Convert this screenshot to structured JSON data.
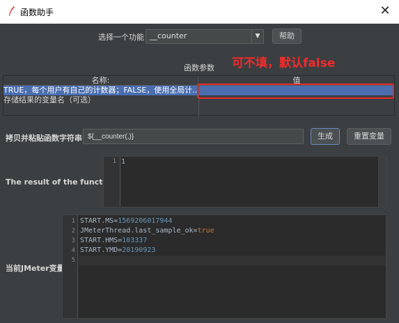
{
  "window": {
    "title": "函数助手",
    "close_glyph": "✕"
  },
  "function_select": {
    "label": "选择一个功能",
    "selected": "__counter",
    "arrow": "▼",
    "help_button": "帮助"
  },
  "params": {
    "section_label": "函数参数",
    "annotation": "可不填，默认false",
    "annotation_color": "#f22b2b",
    "columns": [
      "名称:",
      "值"
    ],
    "rows": [
      {
        "name": "TRUE，每个用户有自己的计数器；FALSE，使用全局计...",
        "value": ""
      },
      {
        "name": "存储结果的变量名（可选）",
        "value": ""
      }
    ]
  },
  "function_string": {
    "label": "拷贝并粘贴函数字符串",
    "value": "${__counter(,)}",
    "generate_button": "生成",
    "reset_button": "重置变量"
  },
  "result": {
    "label": "The result of the function is",
    "line_numbers": [
      "1"
    ],
    "lines": [
      "1"
    ]
  },
  "jmeter_vars": {
    "label": "当前JMeter变量",
    "line_numbers": [
      "1",
      "2",
      "3",
      "4",
      "5"
    ],
    "lines": [
      {
        "key": "START.MS=",
        "value": "1569206017944"
      },
      {
        "key": "JMeterThread.last_sample_ok=",
        "value": "true"
      },
      {
        "key": "START.HMS=",
        "value": "103337"
      },
      {
        "key": "START.YMD=",
        "value": "20190923"
      }
    ]
  }
}
